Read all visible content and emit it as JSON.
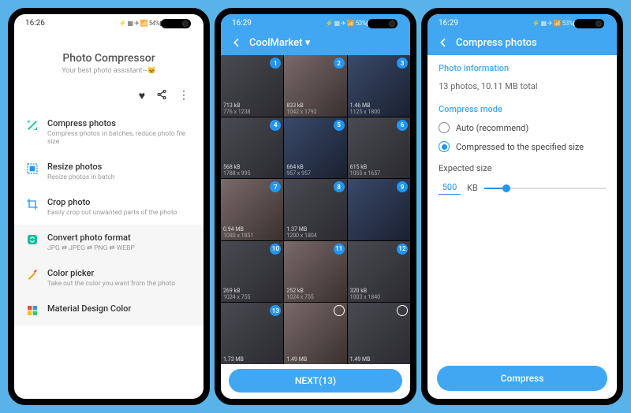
{
  "phone1": {
    "status_time": "16:26",
    "status_battery": "54%",
    "hero_title": "Photo Compressor",
    "hero_subtitle": "Your best photo assistant~🐱",
    "items": [
      {
        "title": "Compress photos",
        "sub": "Compress photos in batches, reduce photo file size"
      },
      {
        "title": "Resize photos",
        "sub": "Resize photos in batch"
      },
      {
        "title": "Crop photo",
        "sub": "Easily crop out unwanted parts of the photo"
      },
      {
        "title": "Convert photo format",
        "sub": "JPG ⇄ JPEG ⇄ PNG ⇄ WEBP"
      },
      {
        "title": "Color picker",
        "sub": "Take out the color you want from the photo"
      },
      {
        "title": "Material Design Color",
        "sub": ""
      }
    ]
  },
  "phone2": {
    "status_time": "16:29",
    "status_battery": "53%",
    "header_title": "CoolMarket",
    "next_label": "NEXT(13)",
    "cells": [
      {
        "size": "713 kB",
        "dim": "776 x 1238",
        "n": "1"
      },
      {
        "size": "833 kB",
        "dim": "1042 x 1792",
        "n": "2"
      },
      {
        "size": "1.46 MB",
        "dim": "1125 x 1800",
        "n": "3"
      },
      {
        "size": "568 kB",
        "dim": "1788 x 995",
        "n": "4"
      },
      {
        "size": "664 kB",
        "dim": "957 x 957",
        "n": "5"
      },
      {
        "size": "615 kB",
        "dim": "1055 x 1657",
        "n": "6"
      },
      {
        "size": "0.94 MB",
        "dim": "1080 x 1851",
        "n": "7"
      },
      {
        "size": "1.37 MB",
        "dim": "1200 x 1804",
        "n": "8"
      },
      {
        "size": "",
        "dim": "",
        "n": "9"
      },
      {
        "size": "269 kB",
        "dim": "1024 x 755",
        "n": "10"
      },
      {
        "size": "252 kB",
        "dim": "1024 x 755",
        "n": "11"
      },
      {
        "size": "320 kB",
        "dim": "1003 x 1840",
        "n": "12"
      },
      {
        "size": "1.73 MB",
        "dim": "",
        "n": "13"
      },
      {
        "size": "1.49 MB",
        "dim": "",
        "n": ""
      },
      {
        "size": "1.49 MB",
        "dim": "",
        "n": ""
      }
    ]
  },
  "phone3": {
    "status_time": "16:29",
    "status_battery": "53%",
    "header_title": "Compress photos",
    "section_info_label": "Photo information",
    "section_info_value": "13 photos, 10.11 MB total",
    "section_mode_label": "Compress mode",
    "mode_options": [
      {
        "label": "Auto (recommend)",
        "selected": false
      },
      {
        "label": "Compressed to the specified size",
        "selected": true
      }
    ],
    "expected_label": "Expected size",
    "expected_value": "500",
    "expected_unit": "KB",
    "slider_percent": 18,
    "compress_label": "Compress"
  }
}
